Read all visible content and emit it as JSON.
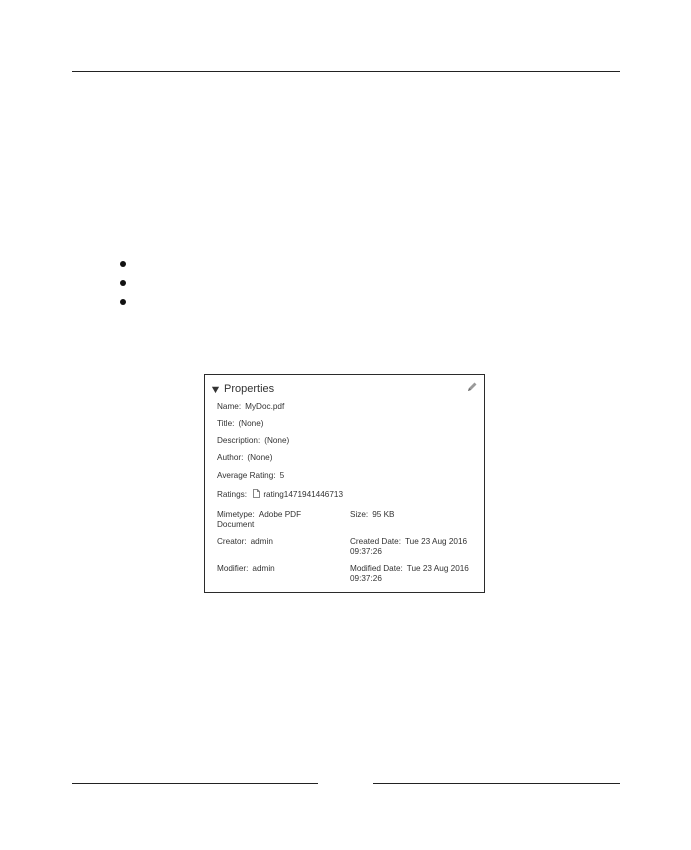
{
  "panel": {
    "title": "Properties",
    "icons": {
      "toggle": "triangle-down-icon",
      "edit": "pencil-icon",
      "file": "document-icon"
    },
    "name_label": "Name:",
    "name_value": "MyDoc.pdf",
    "title_label": "Title:",
    "title_value": "(None)",
    "description_label": "Description:",
    "description_value": "(None)",
    "author_label": "Author:",
    "author_value": "(None)",
    "avg_rating_label": "Average Rating:",
    "avg_rating_value": "5",
    "ratings_label": "Ratings:",
    "ratings_value": "rating1471941446713",
    "mimetype_label": "Mimetype:",
    "mimetype_value": "Adobe PDF Document",
    "size_label": "Size:",
    "size_value": "95 KB",
    "creator_label": "Creator:",
    "creator_value": "admin",
    "created_label": "Created Date:",
    "created_value": "Tue 23 Aug 2016 09:37:26",
    "modifier_label": "Modifier:",
    "modifier_value": "admin",
    "modified_label": "Modified Date:",
    "modified_value": "Tue 23 Aug 2016 09:37:26"
  }
}
